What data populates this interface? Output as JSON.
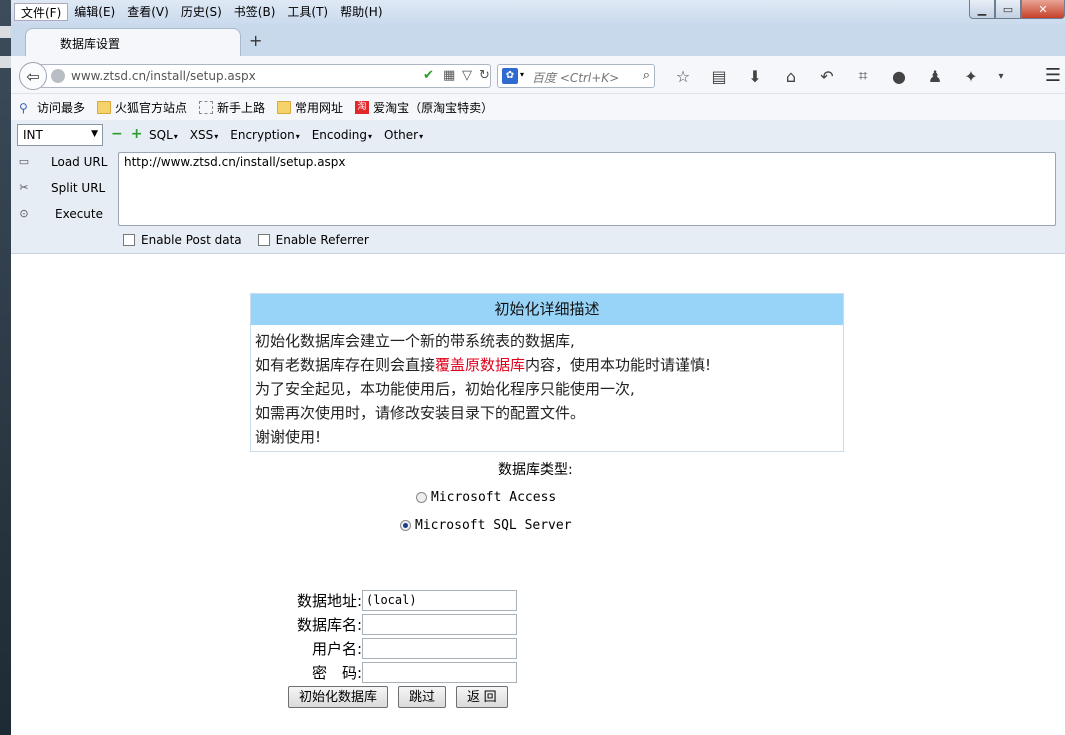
{
  "menubar": [
    "文件(F)",
    "编辑(E)",
    "查看(V)",
    "历史(S)",
    "书签(B)",
    "工具(T)",
    "帮助(H)"
  ],
  "tab": {
    "title": "数据库设置",
    "new_tab": "+"
  },
  "nav": {
    "url": "www.ztsd.cn/install/setup.aspx",
    "search_placeholder": "百度 <Ctrl+K>"
  },
  "bookmarks": [
    "访问最多",
    "火狐官方站点",
    "新手上路",
    "常用网址",
    "爱淘宝（原淘宝特卖）"
  ],
  "hackbar": {
    "select": "INT",
    "menus": [
      "SQL",
      "XSS",
      "Encryption",
      "Encoding",
      "Other"
    ],
    "actions": [
      "Load URL",
      "Split URL",
      "Execute"
    ],
    "textarea": "http://www.ztsd.cn/install/setup.aspx",
    "checks": [
      "Enable Post data",
      "Enable Referrer"
    ]
  },
  "page": {
    "desc_title": "初始化详细描述",
    "desc_line1": "初始化数据库会建立一个新的带系统表的数据库,",
    "desc_line2_a": "如有老数据库存在则会直接",
    "desc_line2_red": "覆盖原数据库",
    "desc_line2_b": "内容，使用本功能时请谨慎!",
    "desc_line3": "为了安全起见，本功能使用后，初始化程序只能使用一次,",
    "desc_line4": "如需再次使用时，请修改安装目录下的配置文件。",
    "desc_line5": "谢谢使用!",
    "db_type_label": "数据库类型:",
    "options": [
      {
        "label": "Microsoft Access",
        "checked": false
      },
      {
        "label": "Microsoft SQL Server",
        "checked": true
      }
    ],
    "fields": [
      {
        "label": "数据地址:",
        "value": "(local)"
      },
      {
        "label": "数据库名:",
        "value": ""
      },
      {
        "label": "用户名:",
        "value": ""
      },
      {
        "label": "密　码:",
        "value": ""
      }
    ],
    "buttons": [
      "初始化数据库",
      "跳过",
      "返 回"
    ]
  }
}
